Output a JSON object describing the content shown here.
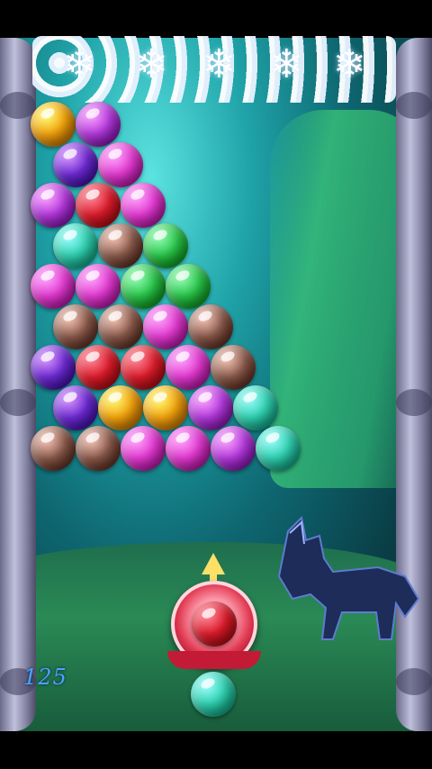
{
  "score": {
    "value": "125"
  },
  "bubble_colors": {
    "gold": "#f2a20c",
    "purple": "#6d2ad2",
    "violet": "#b339dc",
    "magenta": "#e23ad0",
    "red": "#dc1c2c",
    "teal": "#2fd0b0",
    "brown": "#8a5a4c",
    "green": "#29c44a"
  },
  "grid": [
    [
      "gold",
      "violet"
    ],
    [
      "purple",
      "magenta"
    ],
    [
      "violet",
      "red",
      "magenta"
    ],
    [
      "teal",
      "brown",
      "green"
    ],
    [
      "magenta",
      "magenta",
      "green",
      "green"
    ],
    [
      "brown",
      "brown",
      "magenta",
      "brown"
    ],
    [
      "purple",
      "red",
      "red",
      "magenta",
      "brown"
    ],
    [
      "purple",
      "gold",
      "gold",
      "violet",
      "teal"
    ],
    [
      "brown",
      "brown",
      "magenta",
      "magenta",
      "violet",
      "teal"
    ]
  ],
  "current_bubble": "red",
  "next_bubble": "teal",
  "icons": {
    "aim_arrow": "aim-arrow-icon",
    "snowflake": "snowflake-icon"
  }
}
